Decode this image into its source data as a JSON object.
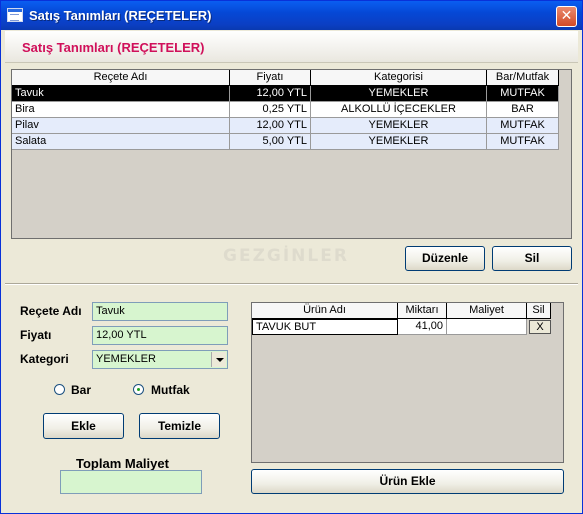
{
  "window": {
    "title": "Satış Tanımları (REÇETELER)",
    "close_glyph": "✕"
  },
  "banner": {
    "title": "Satış Tanımları  (REÇETELER)"
  },
  "recipes": {
    "columns": [
      "Reçete Adı",
      "Fiyatı",
      "Kategorisi",
      "Bar/Mutfak"
    ],
    "rows": [
      {
        "name": "Tavuk",
        "price": "12,00 YTL",
        "category": "YEMEKLER",
        "place": "MUTFAK"
      },
      {
        "name": "Bira",
        "price": "0,25 YTL",
        "category": "ALKOLLÜ İÇECEKLER",
        "place": "BAR"
      },
      {
        "name": "Pilav",
        "price": "12,00 YTL",
        "category": "YEMEKLER",
        "place": "MUTFAK"
      },
      {
        "name": "Salata",
        "price": "5,00 YTL",
        "category": "YEMEKLER",
        "place": "MUTFAK"
      }
    ]
  },
  "watermark": "GEZGİNLER",
  "actions": {
    "edit_label": "Düzenle",
    "delete_label": "Sil"
  },
  "form": {
    "name_label": "Reçete Adı",
    "name_value": "Tavuk",
    "price_label": "Fiyatı",
    "price_value": "12,00 YTL",
    "category_label": "Kategori",
    "category_value": "YEMEKLER",
    "bar_label": "Bar",
    "kitchen_label": "Mutfak",
    "selected_place": "Mutfak",
    "add_label": "Ekle",
    "clear_label": "Temizle",
    "total_cost_label": "Toplam Maliyet",
    "total_cost_value": ""
  },
  "ingredients": {
    "columns": [
      "Ürün Adı",
      "Miktarı",
      "Maliyet",
      "Sil"
    ],
    "rows": [
      {
        "name": "TAVUK BUT",
        "qty": "41,00",
        "cost": "",
        "del": "X"
      }
    ],
    "add_label": "Ürün Ekle"
  },
  "colors": {
    "banner_text": "#d0105a",
    "input_bg": "#d7f5cf",
    "titlebar": "#0548d6"
  },
  "icons": {
    "title": "window-form-icon",
    "close": "close-icon",
    "dropdown": "chevron-down-icon"
  }
}
